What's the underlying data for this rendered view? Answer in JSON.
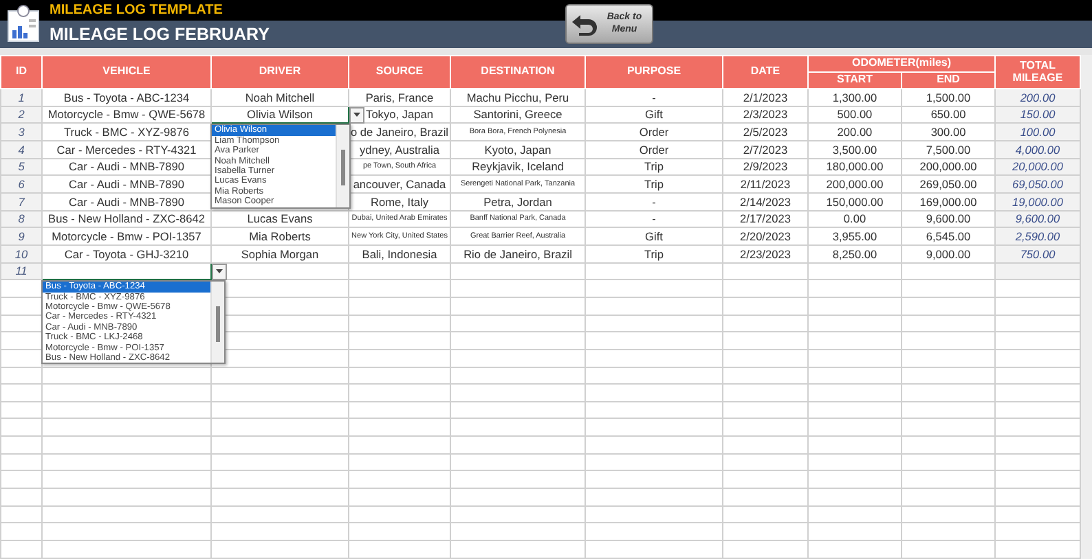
{
  "app": {
    "title": "MILEAGE LOG TEMPLATE",
    "subtitle": "MILEAGE LOG FEBRUARY",
    "back_button": "Back to Menu"
  },
  "table": {
    "columns": [
      "ID",
      "VEHICLE",
      "DRIVER",
      "SOURCE",
      "DESTINATION",
      "PURPOSE",
      "DATE",
      "START",
      "END",
      "TOTAL MILEAGE"
    ],
    "odometer_group": "ODOMETER(miles)",
    "rows": [
      {
        "cells": [
          {
            "text": "1"
          },
          {
            "text": "Bus - Toyota - ABC-1234"
          },
          {
            "text": "Noah Mitchell"
          },
          {
            "text": "Paris, France"
          },
          {
            "text": "Machu Picchu, Peru"
          },
          {
            "text": "-"
          },
          {
            "text": "2/1/2023"
          },
          {
            "text": "1,300.00"
          },
          {
            "text": "1,500.00"
          },
          {
            "text": "200.00"
          }
        ]
      },
      {
        "cells": [
          {
            "text": "2"
          },
          {
            "text": "Motorcycle - Bmw - QWE-5678"
          },
          {
            "text": "Olivia Wilson",
            "dropdown": [
              {
                "label": "Olivia Wilson",
                "selected": true
              },
              {
                "label": "Liam Thompson",
                "selected": false
              },
              {
                "label": "Ava Parker",
                "selected": false
              },
              {
                "label": "Noah Mitchell",
                "selected": false
              },
              {
                "label": "Isabella Turner",
                "selected": false
              },
              {
                "label": "Lucas Evans",
                "selected": false
              },
              {
                "label": "Mia Roberts",
                "selected": false
              },
              {
                "label": "Mason Cooper",
                "selected": false
              }
            ]
          },
          {
            "text": "Tokyo, Japan"
          },
          {
            "text": "Santorini, Greece"
          },
          {
            "text": "Gift"
          },
          {
            "text": "2/3/2023"
          },
          {
            "text": "500.00"
          },
          {
            "text": "650.00"
          },
          {
            "text": "150.00"
          }
        ]
      },
      {
        "cells": [
          {
            "text": "3"
          },
          {
            "text": "Truck - BMC - XYZ-9876"
          },
          {},
          {
            "text": "o de Janeiro, Brazil"
          },
          {
            "text": "Bora Bora, French Polynesia",
            "small": true
          },
          {
            "text": "Order"
          },
          {
            "text": "2/5/2023"
          },
          {
            "text": "200.00"
          },
          {
            "text": "300.00"
          },
          {
            "text": "100.00"
          }
        ]
      },
      {
        "cells": [
          {
            "text": "4"
          },
          {
            "text": "Car - Mercedes - RTY-4321"
          },
          {},
          {
            "text": "ydney, Australia"
          },
          {
            "text": "Kyoto, Japan"
          },
          {
            "text": "Order"
          },
          {
            "text": "2/7/2023"
          },
          {
            "text": "3,500.00"
          },
          {
            "text": "7,500.00"
          },
          {
            "text": "4,000.00"
          }
        ]
      },
      {
        "cells": [
          {
            "text": "5"
          },
          {
            "text": "Car - Audi - MNB-7890"
          },
          {},
          {
            "text": "pe Town, South Africa",
            "small": true
          },
          {
            "text": "Reykjavik, Iceland"
          },
          {
            "text": "Trip"
          },
          {
            "text": "2/9/2023"
          },
          {
            "text": "180,000.00"
          },
          {
            "text": "200,000.00"
          },
          {
            "text": "20,000.00"
          }
        ]
      },
      {
        "cells": [
          {
            "text": "6"
          },
          {
            "text": "Car - Audi - MNB-7890"
          },
          {},
          {
            "text": "ancouver, Canada"
          },
          {
            "text": "Serengeti National Park, Tanzania",
            "small": true
          },
          {
            "text": "Trip"
          },
          {
            "text": "2/11/2023"
          },
          {
            "text": "200,000.00"
          },
          {
            "text": "269,050.00"
          },
          {
            "text": "69,050.00"
          }
        ]
      },
      {
        "cells": [
          {
            "text": "7"
          },
          {
            "text": "Car - Audi - MNB-7890"
          },
          {},
          {
            "text": "Rome, Italy"
          },
          {
            "text": "Petra, Jordan"
          },
          {
            "text": "-"
          },
          {
            "text": "2/14/2023"
          },
          {
            "text": "150,000.00"
          },
          {
            "text": "169,000.00"
          },
          {
            "text": "19,000.00"
          }
        ]
      },
      {
        "cells": [
          {
            "text": "8"
          },
          {
            "text": "Bus - New Holland - ZXC-8642"
          },
          {
            "text": "Lucas Evans"
          },
          {
            "text": "Dubai, United Arab Emirates",
            "small": true
          },
          {
            "text": "Banff National Park, Canada",
            "small": true
          },
          {
            "text": "-"
          },
          {
            "text": "2/17/2023"
          },
          {
            "text": "0.00"
          },
          {
            "text": "9,600.00"
          },
          {
            "text": "9,600.00"
          }
        ]
      },
      {
        "cells": [
          {
            "text": "9"
          },
          {
            "text": "Motorcycle - Bmw - POI-1357"
          },
          {
            "text": "Mia Roberts"
          },
          {
            "text": "New York City, United States",
            "small": true
          },
          {
            "text": "Great Barrier Reef, Australia",
            "small": true
          },
          {
            "text": "Gift"
          },
          {
            "text": "2/20/2023"
          },
          {
            "text": "3,955.00"
          },
          {
            "text": "6,545.00"
          },
          {
            "text": "2,590.00"
          }
        ]
      },
      {
        "cells": [
          {
            "text": "10"
          },
          {
            "text": "Car - Toyota - GHJ-3210"
          },
          {
            "text": "Sophia Morgan"
          },
          {
            "text": "Bali, Indonesia"
          },
          {
            "text": "Rio de Janeiro, Brazil"
          },
          {
            "text": "Trip"
          },
          {
            "text": "2/23/2023"
          },
          {
            "text": "8,250.00"
          },
          {
            "text": "9,000.00"
          },
          {
            "text": "750.00"
          }
        ]
      },
      {
        "cells": [
          {
            "text": "11"
          },
          {
            "dropdown": [
              {
                "label": "Bus - Toyota - ABC-1234",
                "selected": true
              },
              {
                "label": "Truck - BMC - XYZ-9876",
                "selected": false
              },
              {
                "label": "Motorcycle - Bmw - QWE-5678",
                "selected": false
              },
              {
                "label": "Car - Mercedes - RTY-4321",
                "selected": false
              },
              {
                "label": "Car - Audi - MNB-7890",
                "selected": false
              },
              {
                "label": "Truck - BMC - LKJ-2468",
                "selected": false
              },
              {
                "label": "Motorcycle - Bmw - POI-1357",
                "selected": false
              },
              {
                "label": "Bus - New Holland - ZXC-8642",
                "selected": false
              }
            ]
          }
        ]
      }
    ]
  }
}
